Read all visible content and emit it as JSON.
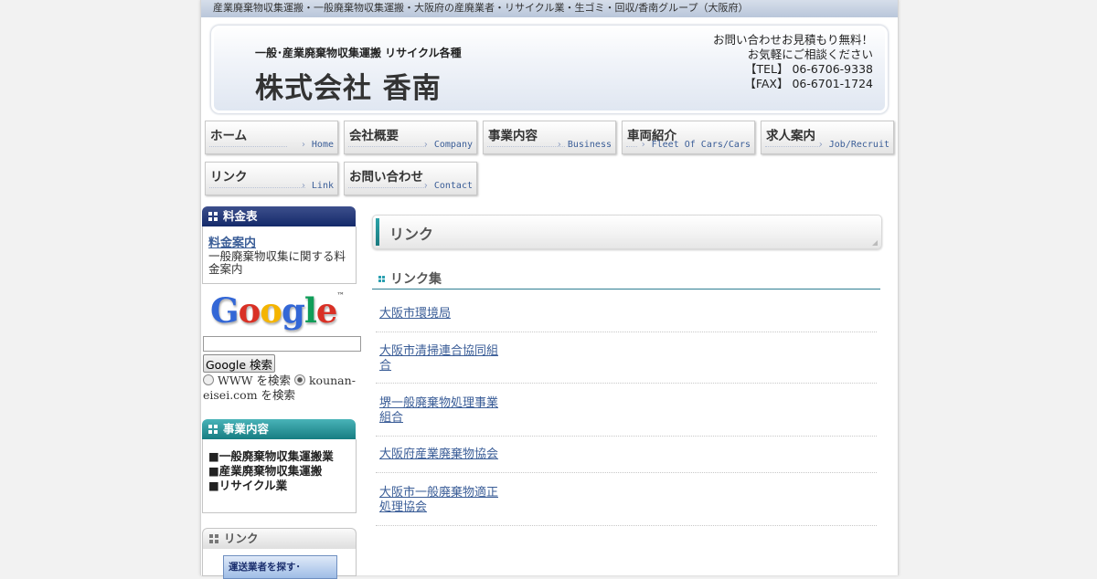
{
  "topbar": {
    "text": "産業廃棄物収集運搬・一般廃棄物収集運搬・大阪府の産廃業者・リサイクル業・生ゴミ・回収/香南グループ（大阪府）"
  },
  "header": {
    "subtitle": "一般･産業廃棄物収集運搬 リサイクル各種",
    "company": "株式会社 香南",
    "contact_lines": [
      "お問い合わせお見積もり無料！",
      "お気軽にご相談ください",
      "【TEL】 06-6706-9338",
      "【FAX】 06-6701-1724"
    ]
  },
  "nav": [
    {
      "jp": "ホーム",
      "en": "Home"
    },
    {
      "jp": "会社概要",
      "en": "Company"
    },
    {
      "jp": "事業内容",
      "en": "Business"
    },
    {
      "jp": "車両紹介",
      "en": "Fleet Of Cars/Cars"
    },
    {
      "jp": "求人案内",
      "en": "Job/Recruit"
    },
    {
      "jp": "リンク",
      "en": "Link"
    },
    {
      "jp": "お問い合わせ",
      "en": "Contact"
    }
  ],
  "sidebar": {
    "price": {
      "heading": "料金表",
      "link": "料金案内",
      "desc": "一般廃棄物収集に関する料金案内"
    },
    "google": {
      "logo": "Google",
      "tm": "™",
      "search_value": "",
      "button": "Google 検索",
      "radio_www": "WWW を検索",
      "radio_site": "kounan-eisei.com を検索",
      "selected": "site"
    },
    "business": {
      "heading": "事業内容",
      "items": [
        "■一般廃棄物収集運搬業",
        "■産業廃棄物収集運搬",
        "■リサイクル業"
      ]
    },
    "links": {
      "heading": "リンク",
      "banner": "運送業者を探す･"
    }
  },
  "main": {
    "title": "リンク",
    "subtitle": "リンク集",
    "links": [
      "大阪市環境局",
      "大阪市清掃連合協同組合",
      "堺一般廃棄物処理事業組合",
      "大阪府産業廃棄物協会",
      "大阪市一般廃棄物適正処理協会"
    ]
  },
  "colors": {
    "accent_navy": "#1b2f6e",
    "accent_teal": "#1e8f96",
    "link_blue": "#3a5d97"
  }
}
